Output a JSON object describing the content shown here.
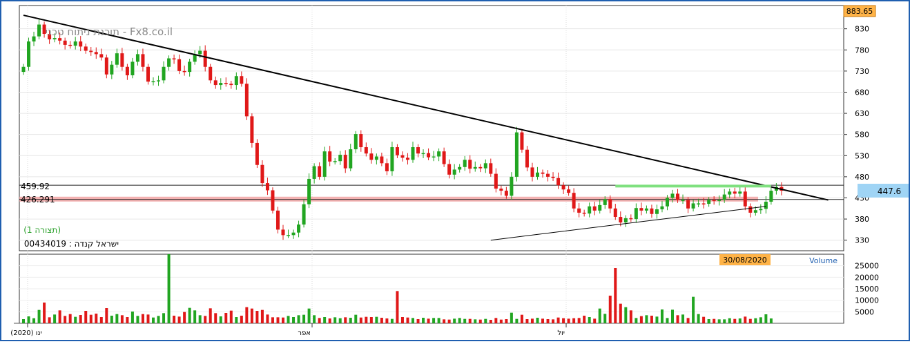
{
  "watermark": "תוכנת ניתוח טכני - Fx8.co.il",
  "symbol": "ישראל קנדה : 00434019",
  "view_label": "(תצורה 1)",
  "last_price": "447.6",
  "max_price": "883.65",
  "date_badge": "30/08/2020",
  "volume_label": "Volume",
  "level_labels": [
    "459.92",
    "426.291"
  ],
  "colors": {
    "up": "#21a521",
    "down": "#e01818",
    "frame": "#1f5fb0",
    "resistance_band": "#f2a5a5",
    "green_line": "#7fe07f",
    "price_badge_bg": "#9fd4f5",
    "date_badge_bg": "#ffb347"
  },
  "chart_data": {
    "type": "candlestick",
    "title": "",
    "price_axis": {
      "ticks": [
        830,
        780,
        730,
        680,
        630,
        580,
        530,
        480,
        430,
        380,
        330
      ],
      "range": [
        305,
        885
      ]
    },
    "volume_axis": {
      "ticks": [
        25000,
        20000,
        15000,
        10000,
        5000
      ],
      "range": [
        0,
        30000
      ]
    },
    "x_ticks": [
      "ינו (2020)",
      "אפר",
      "יול"
    ],
    "horizontal_levels": [
      459.92,
      426.291
    ],
    "trendlines": [
      {
        "name": "falling-resistance",
        "from": [
          0,
          862
        ],
        "to": [
          155,
          425
        ]
      },
      {
        "name": "rising-support",
        "from": [
          90,
          330
        ],
        "to": [
          143,
          410
        ]
      },
      {
        "name": "green-line",
        "from": [
          114,
          458
        ],
        "to": [
          144,
          458
        ]
      }
    ],
    "candles_close": [
      740,
      800,
      812,
      840,
      818,
      805,
      808,
      802,
      792,
      790,
      800,
      788,
      778,
      775,
      770,
      762,
      722,
      745,
      772,
      740,
      720,
      752,
      770,
      740,
      705,
      706,
      708,
      740,
      760,
      758,
      730,
      728,
      752,
      770,
      778,
      740,
      708,
      697,
      702,
      700,
      697,
      718,
      700,
      623,
      560,
      508,
      465,
      448,
      400,
      355,
      342,
      342,
      348,
      367,
      415,
      475,
      505,
      480,
      540,
      516,
      517,
      532,
      500,
      545,
      581,
      550,
      535,
      520,
      528,
      512,
      493,
      550,
      531,
      525,
      520,
      550,
      535,
      536,
      526,
      528,
      540,
      510,
      485,
      497,
      503,
      520,
      499,
      503,
      500,
      512,
      487,
      452,
      447,
      435,
      480,
      585,
      544,
      502,
      480,
      490,
      487,
      480,
      477,
      460,
      450,
      442,
      405,
      395,
      393,
      410,
      400,
      413,
      427,
      405,
      385,
      372,
      382,
      380,
      406,
      400,
      405,
      392,
      403,
      410,
      430,
      440,
      425,
      425,
      405,
      417,
      417,
      416,
      425,
      423,
      425,
      438,
      445,
      440,
      445,
      410,
      395,
      401,
      404,
      421,
      447,
      456,
      447
    ],
    "volume": [
      1800,
      3000,
      2200,
      5800,
      9000,
      2600,
      3800,
      5600,
      3200,
      4000,
      2800,
      3600,
      5400,
      3700,
      4200,
      2700,
      6600,
      3300,
      4000,
      3500,
      2700,
      5100,
      3200,
      4000,
      3800,
      2500,
      3200,
      4400,
      30000,
      3300,
      2900,
      4900,
      6700,
      5600,
      3500,
      3200,
      6500,
      4400,
      3000,
      4500,
      5500,
      2700,
      3300,
      7000,
      6400,
      5400,
      5800,
      3800,
      2600,
      2600,
      2500,
      3200,
      2700,
      3500,
      3700,
      6400,
      3500,
      2300,
      2700,
      2100,
      2600,
      2200,
      2600,
      2400,
      3700,
      2500,
      2800,
      2700,
      2800,
      2400,
      2100,
      1900,
      14000,
      2700,
      2500,
      2300,
      1800,
      2400,
      2000,
      2300,
      2300,
      1700,
      1600,
      2000,
      2300,
      1900,
      1900,
      1700,
      1600,
      1900,
      1500,
      2300,
      1600,
      1800,
      4600,
      1900,
      3700,
      1800,
      2000,
      2400,
      2000,
      1800,
      1700,
      2500,
      2200,
      2000,
      2200,
      2300,
      3300,
      2700,
      2000,
      6400,
      4100,
      12000,
      24000,
      8500,
      7000,
      5600,
      2300,
      3100,
      3500,
      3300,
      2900,
      6000,
      2300,
      5900,
      3500,
      3800,
      2300,
      11500,
      4000,
      2800,
      1800,
      1900,
      1700,
      1700,
      2200,
      1900,
      2100,
      2900,
      1900,
      2200,
      2600,
      3900,
      2100
    ]
  }
}
